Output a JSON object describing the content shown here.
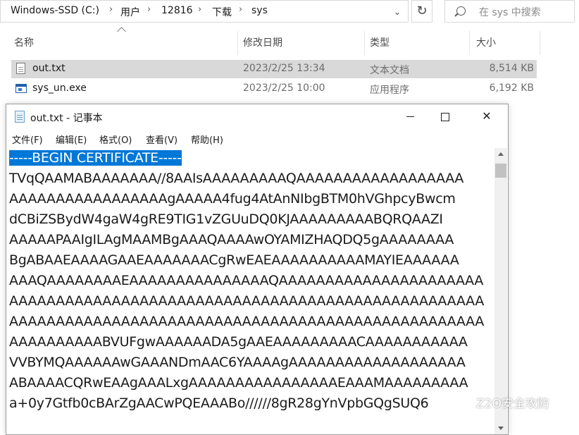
{
  "explorer": {
    "breadcrumb": [
      "Windows-SSD (C:)",
      "用户",
      "12816",
      "下载",
      "sys"
    ],
    "search_placeholder": "在 sys 中搜索",
    "columns": [
      "名称",
      "修改日期",
      "类型",
      "大小"
    ],
    "files": [
      {
        "name": "out.txt",
        "date": "2023/2/25 13:34",
        "type": "文本文档",
        "size": "8,514 KB",
        "selected": true,
        "icon": "text-file-icon"
      },
      {
        "name": "sys_un.exe",
        "date": "2023/2/25 10:00",
        "type": "应用程序",
        "size": "6,192 KB",
        "selected": false,
        "icon": "exe-file-icon"
      }
    ]
  },
  "notepad": {
    "title": "out.txt - 记事本",
    "menu": [
      "文件(F)",
      "编辑(E)",
      "格式(O)",
      "查看(V)",
      "帮助(H)"
    ],
    "lines": [
      "-----BEGIN CERTIFICATE-----",
      "TVqQAAMABAAAAAAA//8AAIsAAAAAAAAAQAAAAAAAAAAAAAAAAAA",
      "AAAAAAAAAAAAAAAAAgAAAAA4fug4AtAnNIbgBTM0hVGhpcyBwcm",
      "dCBiZSBydW4gaW4gRE9TIG1vZGUuDQ0KJAAAAAAAAABQRQAAZI",
      "AAAAAPAAIgILAgMAAMBgAAAQAAAAwOYAMIZHAQDQ5gAAAAAAAA",
      "BgABAAEAAAAGAAEAAAAAAACgRwEAEAAAAAAAAAAMAYIEAAAAAA",
      "AAAQAAAAAAAAEAAAAAAAAAAAAAAAQAAAAAAAAAAAAAAAAAAAAAA",
      "AAAAAAAAAAAAAAAAAAAAAAAAAAAAAAAAAAAAAAAAAAAAAAAAAAA",
      "AAAAAAAAAAAAAAAAAAAAAAAAAAAAAAAAAAAAAAAAAAAAAAAAAAA",
      "AAAAAAAAAABVUFgwAAAAAADA5gAAEAAAAAAAAACAAAAAAAAAAA",
      "VVBYMQAAAAAAwGAAANDmAAC6YAAAAgAAAAAAAAAAAAAAAAAAA",
      "ABAAAACQRwEAAgAAALxgAAAAAAAAAAAAAAAAEAAAMAAAAAAAAA",
      "a+0y7Gtfb0cBArZgAACwPQEAAABo//////8gR28gYnVpbGQgSUQ6"
    ]
  },
  "watermark": "Z2O安全攻防",
  "colors": {
    "selection": "#0078d7",
    "row_selected": "#d9d9d9"
  }
}
